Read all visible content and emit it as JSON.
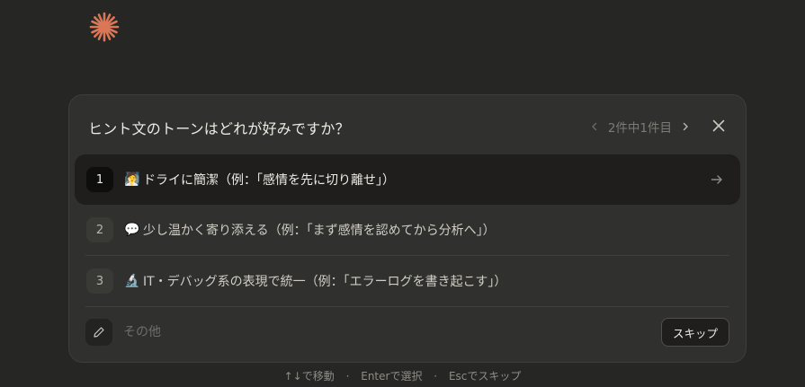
{
  "question": "ヒント文のトーンはどれが好みですか？",
  "pager": {
    "text": "2件中1件目",
    "prev_icon": "chevron-left-icon",
    "next_icon": "chevron-right-icon"
  },
  "close_icon": "close-icon",
  "options": [
    {
      "number": "1",
      "emoji": "🧖",
      "label": "ドライに簡潔（例：「感情を先に切り離せ」）",
      "selected": true
    },
    {
      "number": "2",
      "emoji": "💬",
      "label": "少し温かく寄り添える（例：「まず感情を認めてから分析へ」）",
      "selected": false
    },
    {
      "number": "3",
      "emoji": "🔬",
      "label": "IT・デバッグ系の表現で統一（例：「エラーログを書き起こす」）",
      "selected": false
    }
  ],
  "other": {
    "placeholder": "その他"
  },
  "skip_label": "スキップ",
  "hints": {
    "move": "↑↓で移動",
    "select": "Enterで選択",
    "skip": "Escでスキップ",
    "separator": "·"
  },
  "colors": {
    "background": "#262624",
    "card": "#30302e",
    "selected_row": "#1f1e1c",
    "logo": "#d97757"
  }
}
